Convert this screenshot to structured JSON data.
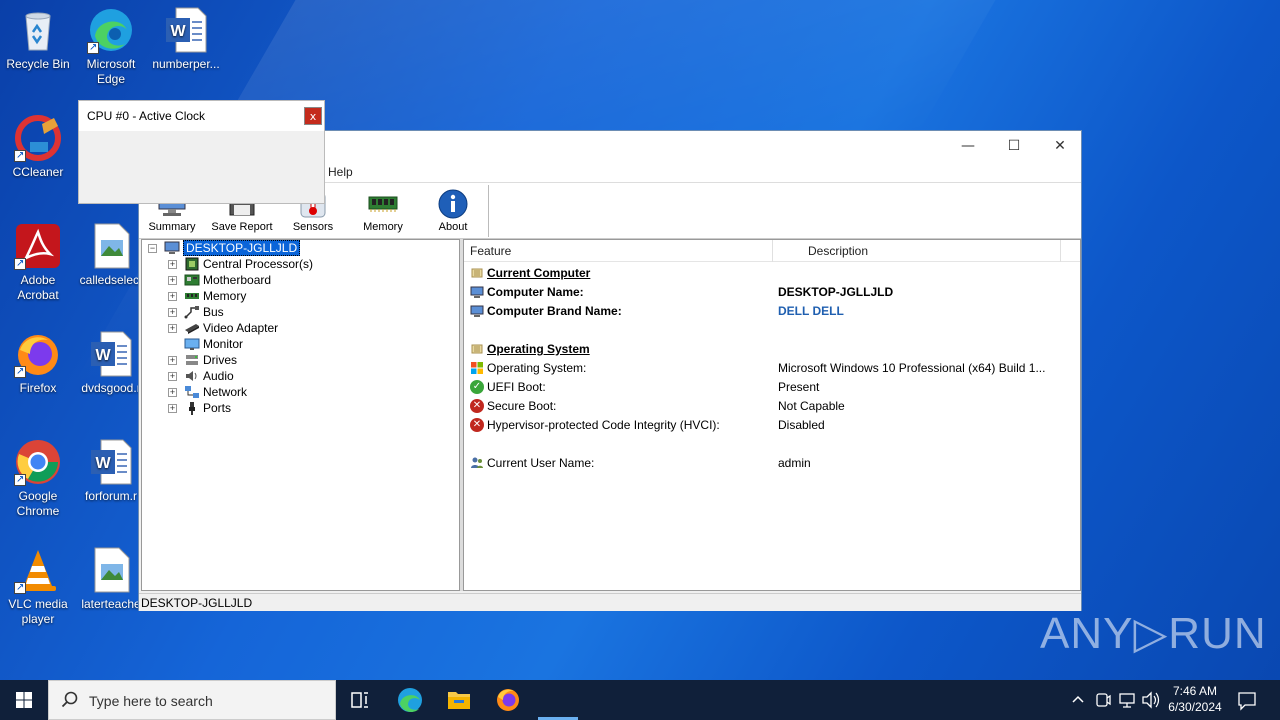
{
  "desktop": {
    "icons": [
      {
        "label": "Recycle Bin"
      },
      {
        "label": "Microsoft Edge"
      },
      {
        "label": "numberper..."
      },
      {
        "label": "CCleaner"
      },
      {
        "label": "Adobe Acrobat"
      },
      {
        "label": "calledselect"
      },
      {
        "label": "Firefox"
      },
      {
        "label": "dvdsgood.r"
      },
      {
        "label": "Google Chrome"
      },
      {
        "label": "forforum.r"
      },
      {
        "label": "VLC media player"
      },
      {
        "label": "laterteache"
      }
    ]
  },
  "popup": {
    "title": "CPU #0 - Active Clock",
    "close": "x"
  },
  "window": {
    "controls": {
      "minimize": "—",
      "maximize": "☐",
      "close": "✕"
    },
    "menu": {
      "help": "Help"
    },
    "toolbar": {
      "summary": "Summary",
      "save_report": "Save Report",
      "sensors": "Sensors",
      "memory": "Memory",
      "about": "About"
    },
    "tree": {
      "root": "DESKTOP-JGLLJLD",
      "items": [
        "Central Processor(s)",
        "Motherboard",
        "Memory",
        "Bus",
        "Video Adapter",
        "Monitor",
        "Drives",
        "Audio",
        "Network",
        "Ports"
      ]
    },
    "detail": {
      "col_feature": "Feature",
      "col_description": "Description",
      "current_computer": "Current Computer",
      "computer_name_label": "Computer Name:",
      "computer_name_value": "DESKTOP-JGLLJLD",
      "brand_label": "Computer Brand Name:",
      "brand_value": "DELL DELL",
      "operating_system": "Operating System",
      "os_label": "Operating System:",
      "os_value": "Microsoft Windows 10 Professional (x64) Build 1...",
      "uefi_label": "UEFI Boot:",
      "uefi_value": "Present",
      "secure_label": "Secure Boot:",
      "secure_value": "Not Capable",
      "hvci_label": "Hypervisor-protected Code Integrity (HVCI):",
      "hvci_value": "Disabled",
      "user_label": "Current User Name:",
      "user_value": "admin"
    },
    "status": "DESKTOP-JGLLJLD"
  },
  "taskbar": {
    "search_placeholder": "Type here to search",
    "time": "7:46 AM",
    "date": "6/30/2024"
  },
  "watermark": "ANY▷RUN"
}
